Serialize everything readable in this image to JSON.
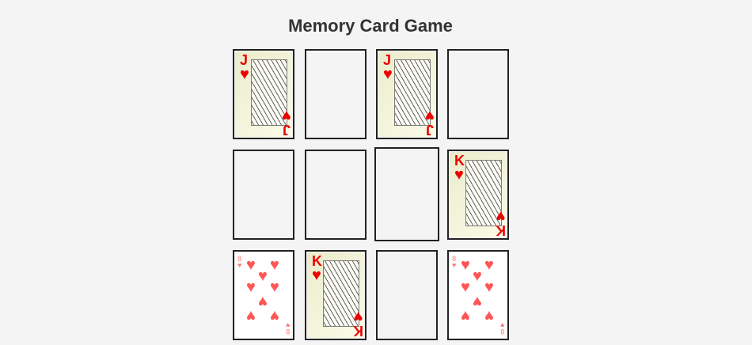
{
  "title": "Memory Card Game",
  "cards": [
    {
      "state": "face-up",
      "rank": "J",
      "suit": "♥"
    },
    {
      "state": "face-down"
    },
    {
      "state": "face-up",
      "rank": "J",
      "suit": "♥"
    },
    {
      "state": "face-down"
    },
    {
      "state": "face-down"
    },
    {
      "state": "face-down"
    },
    {
      "state": "face-down"
    },
    {
      "state": "face-up",
      "rank": "K",
      "suit": "♥"
    },
    {
      "state": "face-up",
      "rank": "8",
      "suit": "♥"
    },
    {
      "state": "face-up",
      "rank": "K",
      "suit": "♥"
    },
    {
      "state": "face-down"
    },
    {
      "state": "face-up",
      "rank": "8",
      "suit": "♥"
    }
  ]
}
